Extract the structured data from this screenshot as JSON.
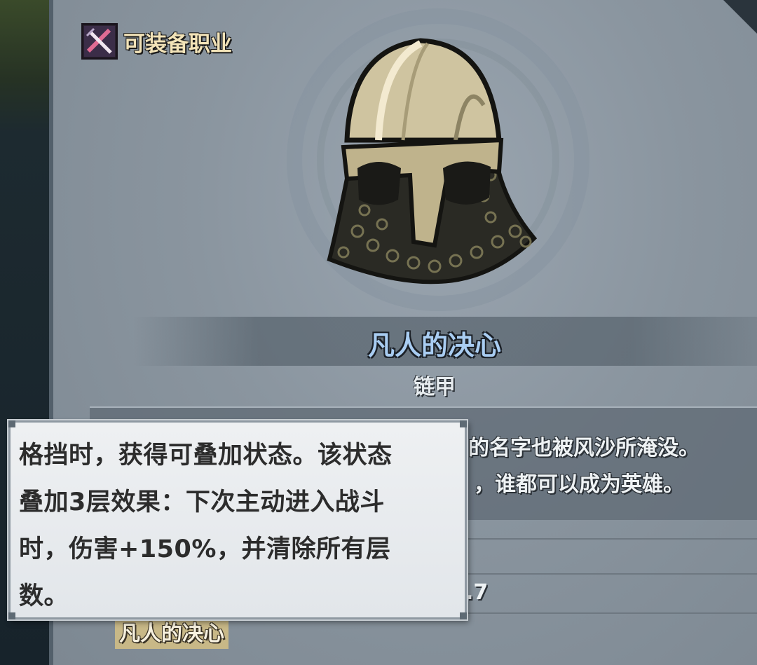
{
  "header": {
    "class_label": "可装备职业",
    "class_icon": "crossed-swords-icon"
  },
  "item": {
    "name": "凡人的决心",
    "type": "链甲",
    "icon": "chainmail-helmet-icon",
    "description_lines": [
      "的名字也被风沙所淹没。",
      "，谁都可以成为英雄。"
    ],
    "stat_value_partial": ".7",
    "skill_tag": "凡人的决心"
  },
  "tooltip": {
    "lines": [
      "格挡时，获得可叠加状态。该状态",
      "叠加3层效果：下次主动进入战斗",
      "时，伤害+150%，并清除所有层",
      "数。"
    ]
  },
  "colors": {
    "item_name": "#a9cdf2",
    "class_label": "#f2e3b8",
    "skill_tag_bg": "#c8b887",
    "tooltip_bg": "#eef0f2"
  }
}
